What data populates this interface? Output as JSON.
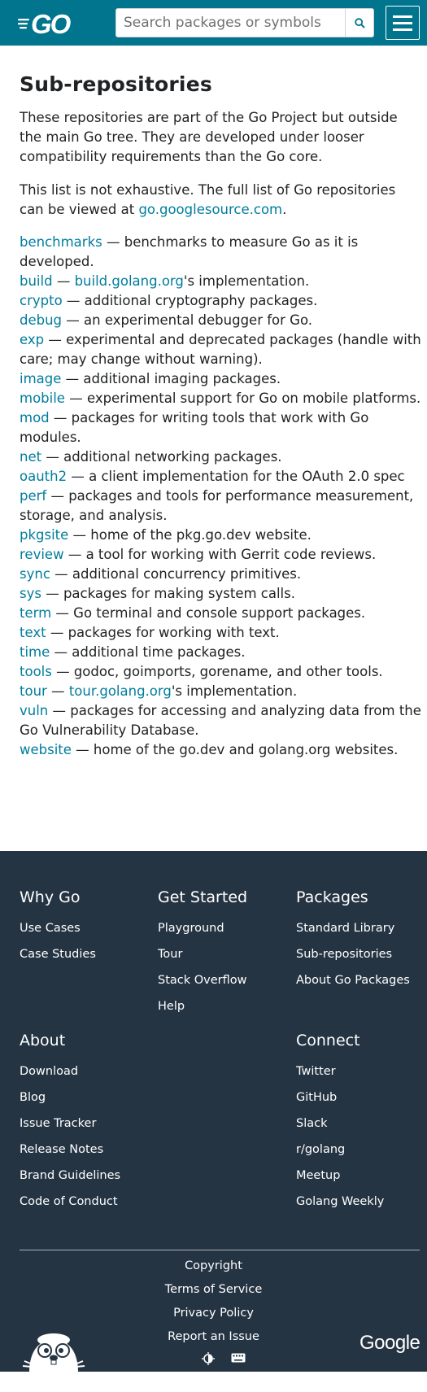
{
  "header": {
    "search_placeholder": "Search packages or symbols",
    "logo": "go-logo"
  },
  "main": {
    "title": "Sub-repositories",
    "intro": "These repositories are part of the Go Project but outside the main Go tree. They are developed under looser compatibility requirements than the Go core.",
    "note_prefix": "This list is not exhaustive. The full list of Go repositories can be viewed at ",
    "note_link": "go.googlesource.com",
    "note_suffix": ".",
    "repos": [
      {
        "name": "benchmarks",
        "desc": " — benchmarks to measure Go as it is developed."
      },
      {
        "name": "build",
        "desc_pre": " — ",
        "link": "build.golang.org",
        "desc": "'s implementation."
      },
      {
        "name": "crypto",
        "desc": " — additional cryptography packages."
      },
      {
        "name": "debug",
        "desc": " — an experimental debugger for Go."
      },
      {
        "name": "exp",
        "desc": " — experimental and deprecated packages (handle with care; may change without warning)."
      },
      {
        "name": "image",
        "desc": " — additional imaging packages."
      },
      {
        "name": "mobile",
        "desc": " — experimental support for Go on mobile platforms."
      },
      {
        "name": "mod",
        "desc": " — packages for writing tools that work with Go modules."
      },
      {
        "name": "net",
        "desc": " — additional networking packages."
      },
      {
        "name": "oauth2",
        "desc": " — a client implementation for the OAuth 2.0 spec"
      },
      {
        "name": "perf",
        "desc": " — packages and tools for performance measurement, storage, and analysis."
      },
      {
        "name": "pkgsite",
        "desc": " — home of the pkg.go.dev website."
      },
      {
        "name": "review",
        "desc": " — a tool for working with Gerrit code reviews."
      },
      {
        "name": "sync",
        "desc": " — additional concurrency primitives."
      },
      {
        "name": "sys",
        "desc": " — packages for making system calls."
      },
      {
        "name": "term",
        "desc": " — Go terminal and console support packages."
      },
      {
        "name": "text",
        "desc": " — packages for working with text."
      },
      {
        "name": "time",
        "desc": " — additional time packages."
      },
      {
        "name": "tools",
        "desc": " — godoc, goimports, gorename, and other tools."
      },
      {
        "name": "tour",
        "desc_pre": " — ",
        "link": "tour.golang.org",
        "desc": "'s implementation."
      },
      {
        "name": "vuln",
        "desc": " — packages for accessing and analyzing data from the Go Vulnerability Database."
      },
      {
        "name": "website",
        "desc": " — home of the go.dev and golang.org websites."
      }
    ]
  },
  "footer": {
    "columns": [
      {
        "title": "Why Go",
        "links": [
          "Use Cases",
          "Case Studies"
        ]
      },
      {
        "title": "Get Started",
        "links": [
          "Playground",
          "Tour",
          "Stack Overflow",
          "Help"
        ]
      },
      {
        "title": "Packages",
        "links": [
          "Standard Library",
          "Sub-repositories",
          "About Go Packages"
        ]
      },
      {
        "title": "About",
        "links": [
          "Download",
          "Blog",
          "Issue Tracker",
          "Release Notes",
          "Brand Guidelines",
          "Code of Conduct"
        ]
      },
      {
        "title": "Connect",
        "links": [
          "Twitter",
          "GitHub",
          "Slack",
          "r/golang",
          "Meetup",
          "Golang Weekly"
        ]
      }
    ],
    "legal_links": [
      "Copyright",
      "Terms of Service",
      "Privacy Policy",
      "Report an Issue"
    ],
    "google_logo": "Google",
    "icons": [
      "theme-toggle-icon",
      "keyboard-icon"
    ]
  }
}
